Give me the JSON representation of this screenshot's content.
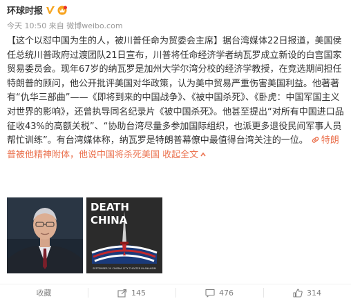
{
  "author": {
    "name": "环球时报",
    "verified_icon": "verified-v-icon",
    "vip_icon": "vip-crown-icon"
  },
  "meta": {
    "time": "今天 10:50",
    "source_prefix": "来自",
    "source": "微博weibo.com"
  },
  "post": {
    "seg1": "【这个以怼中国为生的人，被川普任命为贸委会主席】据台湾媒体22日报道，美国侯任总统川普政府过渡团队21日宣布，川普将任命经济学者纳瓦罗成立新设的白宫国家贸易委员会。现年67岁的纳瓦罗是加州大学尔湾分校的经济学教授，在竞选期间担任特朗普的顾问，他公开批评美国对华政策，认为美中贸易严重伤害美国利益。他著著有“仇华三部曲”——《即将到来的中国战争》、《被中国杀死》、《卧虎：中国军国主义对世界的影响》，还曾执导同名纪录片《被中国杀死》。他甚至提出“对所有中国进口品征收43%的高额关税”、“协助台湾尽量多参加国际组织，也派更多退役民间军事人员帮忙训练”。有台湾媒体称，纳瓦罗是特朗普幕僚中最值得台湾关注的一位。",
    "link_text": "特朗普被他精神附体，他说中国将杀死美国",
    "link_icon": "link-icon",
    "collapse": "收起全文",
    "collapse_icon": "caret-up-icon"
  },
  "images": [
    {
      "name": "navarro-portrait"
    },
    {
      "name": "death-by-china-poster",
      "title_line1": "DEATH",
      "title_line2": "CHINA",
      "caption": "SEPTEMBER 20 CINEMA CITY THEATER IN ANAHEIM"
    }
  ],
  "actions": {
    "favorite_label": "收藏",
    "share_count": "145",
    "comment_count": "476",
    "like_count": "314"
  }
}
